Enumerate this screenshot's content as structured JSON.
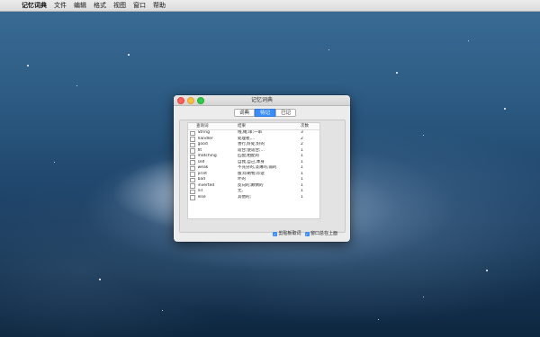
{
  "menubar": {
    "apple_icon": "",
    "items": [
      "记忆词典",
      "文件",
      "编辑",
      "格式",
      "视图",
      "窗口",
      "帮助"
    ]
  },
  "window": {
    "title": "记忆词典",
    "tabs": [
      {
        "label": "词典",
        "active": false
      },
      {
        "label": "待记",
        "active": true
      },
      {
        "label": "已记",
        "active": false
      }
    ],
    "table": {
      "headers": [
        "查询词",
        "结果",
        "次数"
      ],
      "rows": [
        {
          "word": "String",
          "trans": "线,绳;串;一串",
          "count": "3"
        },
        {
          "word": "handler",
          "trans": "处理者,...",
          "count": "2"
        },
        {
          "word": "good",
          "trans": "善行,好处;好的",
          "count": "2"
        },
        {
          "word": "fit",
          "trans": "适合;使适合;...",
          "count": "1"
        },
        {
          "word": "matching",
          "trans": "匹配;相配的",
          "count": "1"
        },
        {
          "word": "self",
          "trans": "自我,自己,本身",
          "count": "1"
        },
        {
          "word": "weak",
          "trans": "不充分的,淡薄的,弱的",
          "count": "1"
        },
        {
          "word": "print",
          "trans": "版;印刷物,印迹",
          "count": "1"
        },
        {
          "word": "bad",
          "trans": "坏的",
          "count": "1"
        },
        {
          "word": "inverted",
          "trans": "反向的;颠倒的",
          "count": "1"
        },
        {
          "word": "nil",
          "trans": "无,",
          "count": "1"
        },
        {
          "word": "else",
          "trans": "其他的;",
          "count": "1"
        }
      ]
    },
    "options": [
      {
        "label": "剪贴板取词",
        "checked": true
      },
      {
        "label": "窗口总在上面",
        "checked": true
      }
    ]
  },
  "colors": {
    "accent": "#3a8ef6",
    "close": "#fc605c",
    "minimize": "#fdbc40",
    "maximize": "#34c84a"
  }
}
